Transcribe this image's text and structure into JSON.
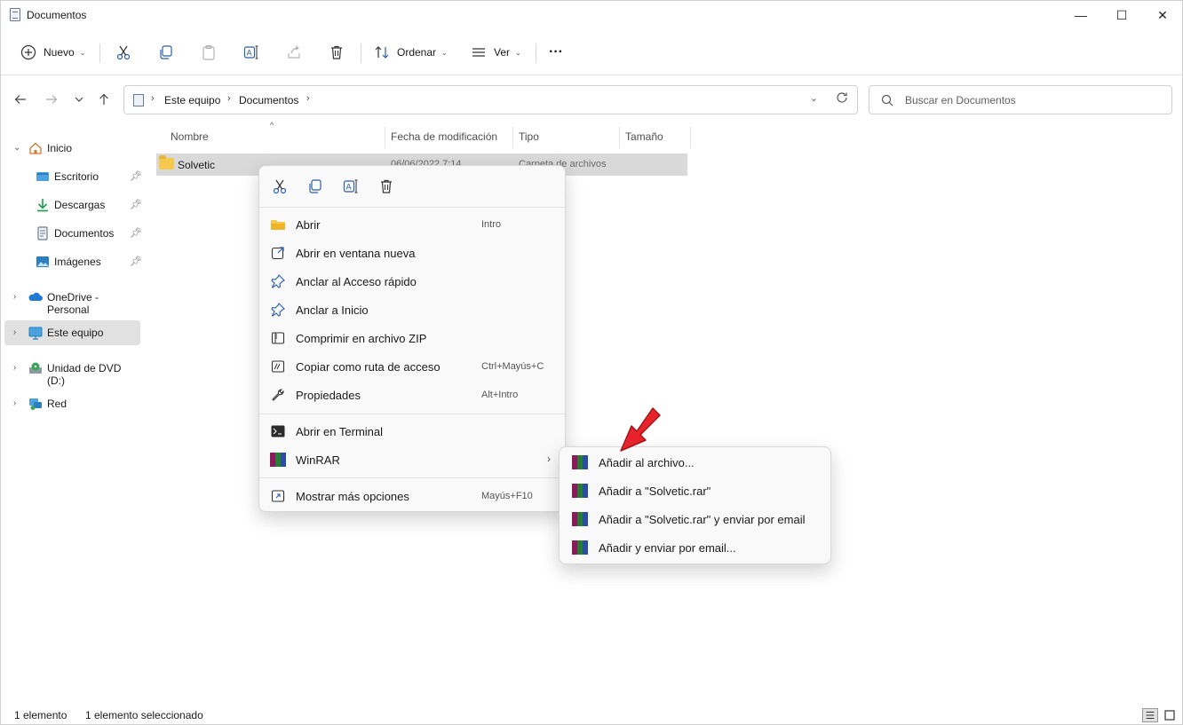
{
  "window": {
    "title": "Documentos",
    "controls": {
      "minimize": "—",
      "maximize": "☐",
      "close": "✕"
    }
  },
  "commandbar": {
    "new_label": "Nuevo",
    "sort_label": "Ordenar",
    "view_label": "Ver",
    "more_label": "···",
    "icons": [
      "cut-icon",
      "copy-icon",
      "paste-icon",
      "rename-icon",
      "share-icon",
      "delete-icon"
    ]
  },
  "address": {
    "crumbs": [
      "Este equipo",
      "Documentos"
    ],
    "chevron": "›"
  },
  "search": {
    "placeholder": "Buscar en Documentos"
  },
  "sidebar": {
    "items": [
      {
        "label": "Inicio"
      },
      {
        "label": "Escritorio",
        "pinned": true
      },
      {
        "label": "Descargas",
        "pinned": true
      },
      {
        "label": "Documentos",
        "pinned": true
      },
      {
        "label": "Imágenes",
        "pinned": true
      },
      {
        "label": "OneDrive - Personal"
      },
      {
        "label": "Este equipo",
        "selected": true
      },
      {
        "label": "Unidad de DVD (D:)"
      },
      {
        "label": "Red"
      }
    ]
  },
  "filelist": {
    "columns": [
      "Nombre",
      "Fecha de modificación",
      "Tipo",
      "Tamaño"
    ],
    "rows": [
      {
        "name": "Solvetic",
        "date": "06/06/2022 7:14",
        "type": "Carpeta de archivos",
        "size": ""
      }
    ]
  },
  "context_menu": {
    "top_icons": [
      "cut-icon",
      "copy-icon",
      "rename-icon",
      "delete-icon"
    ],
    "items": [
      {
        "label": "Abrir",
        "shortcut": "Intro"
      },
      {
        "label": "Abrir en ventana nueva",
        "shortcut": ""
      },
      {
        "label": "Anclar al Acceso rápido",
        "shortcut": ""
      },
      {
        "label": "Anclar a Inicio",
        "shortcut": ""
      },
      {
        "label": "Comprimir en archivo ZIP",
        "shortcut": ""
      },
      {
        "label": "Copiar como ruta de acceso",
        "shortcut": "Ctrl+Mayús+C"
      },
      {
        "label": "Propiedades",
        "shortcut": "Alt+Intro"
      },
      {
        "label": "Abrir en Terminal",
        "shortcut": ""
      },
      {
        "label": "WinRAR",
        "shortcut": "",
        "submenu": "›"
      },
      {
        "label": "Mostrar más opciones",
        "shortcut": "Mayús+F10"
      }
    ]
  },
  "winrar_submenu": {
    "items": [
      {
        "label": "Añadir al archivo..."
      },
      {
        "label": "Añadir a \"Solvetic.rar\""
      },
      {
        "label": "Añadir a \"Solvetic.rar\" y enviar por email"
      },
      {
        "label": "Añadir y enviar por email..."
      }
    ]
  },
  "statusbar": {
    "count": "1 elemento",
    "selected": "1 elemento seleccionado"
  },
  "colors": {
    "accent": "#0067c0",
    "selection": "#d9d9d9",
    "folder": "#f5c94e",
    "arrow": "#e8222a"
  }
}
